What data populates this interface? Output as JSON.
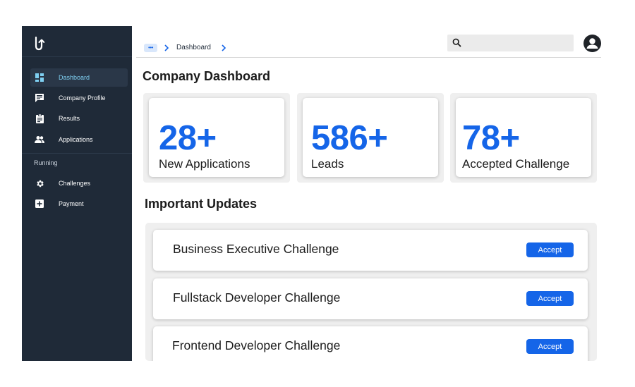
{
  "sidebar": {
    "logo_icon": "uptake-arrow-logo",
    "items": [
      {
        "label": "Dashboard",
        "icon": "dashboard-grid-icon"
      },
      {
        "label": "Company Profile",
        "icon": "chat-bubble-icon"
      },
      {
        "label": "Results",
        "icon": "clipboard-icon"
      },
      {
        "label": "Applications",
        "icon": "people-icon"
      }
    ],
    "section_label": "Running",
    "running_items": [
      {
        "label": "Challenges",
        "icon": "gear-icon"
      },
      {
        "label": "Payment",
        "icon": "plus-box-icon"
      }
    ]
  },
  "header": {
    "breadcrumb": {
      "dots": "•••",
      "current": "Dashboard"
    },
    "search": {
      "placeholder": "",
      "value": ""
    }
  },
  "page": {
    "title": "Company Dashboard"
  },
  "stats": [
    {
      "value": "28+",
      "label": "New Applications"
    },
    {
      "value": "586+",
      "label": "Leads"
    },
    {
      "value": "78+",
      "label": "Accepted Challenge"
    }
  ],
  "updates": {
    "title": "Important Updates",
    "items": [
      {
        "title": "Business Executive Challenge",
        "action": "Accept"
      },
      {
        "title": "Fullstack Developer Challenge",
        "action": "Accept"
      },
      {
        "title": "Frontend Developer Challenge",
        "action": "Accept"
      }
    ]
  },
  "colors": {
    "sidebar_bg": "#1f2a38",
    "accent": "#1565e8",
    "active_label": "#7fd0f2"
  }
}
